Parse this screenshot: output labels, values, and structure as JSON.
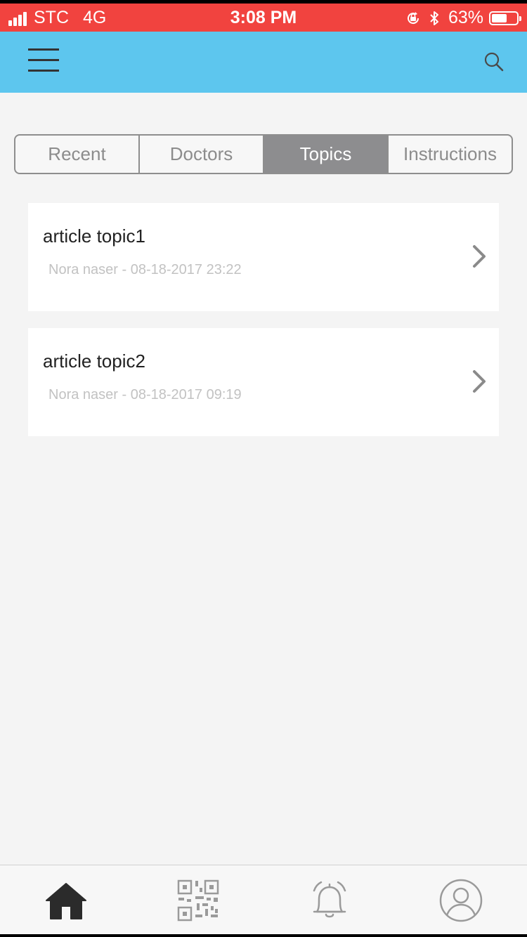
{
  "status_bar": {
    "carrier": "STC",
    "network": "4G",
    "time": "3:08 PM",
    "battery": "63%",
    "battery_level": 0.63,
    "icons": [
      "signal-icon",
      "orientation-lock-icon",
      "bluetooth-icon",
      "battery-icon"
    ]
  },
  "navbar": {
    "menu_icon": "hamburger-icon",
    "search_icon": "search-icon"
  },
  "segments": [
    {
      "label": "Recent",
      "selected": false
    },
    {
      "label": "Doctors",
      "selected": false
    },
    {
      "label": "Topics",
      "selected": true
    },
    {
      "label": "Instructions",
      "selected": false
    }
  ],
  "articles": [
    {
      "title": "article topic1",
      "meta": "Nora naser - 08-18-2017 23:22"
    },
    {
      "title": "article topic2",
      "meta": "Nora naser - 08-18-2017 09:19"
    }
  ],
  "tab_bar": [
    {
      "icon": "home-icon",
      "selected": true
    },
    {
      "icon": "qr-code-icon",
      "selected": false
    },
    {
      "icon": "bell-icon",
      "selected": false
    },
    {
      "icon": "profile-icon",
      "selected": false
    }
  ],
  "colors": {
    "status_bar": "#f1433f",
    "nav_bar": "#5dc6ee",
    "segment_active": "#8d8d8f",
    "background": "#f4f4f4"
  }
}
